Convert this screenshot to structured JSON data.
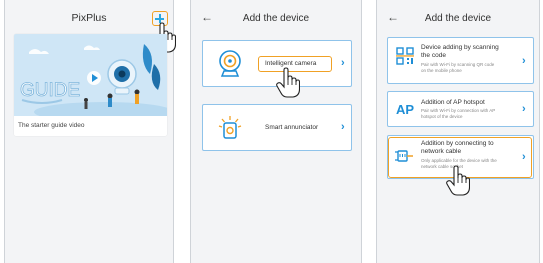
{
  "screen1": {
    "title": "PixPlus",
    "guide_caption": "The starter guide video",
    "guide_art_text": "GUIDE"
  },
  "screen2": {
    "title": "Add the device",
    "items": [
      {
        "label": "Intelligent camera",
        "icon": "camera-icon"
      },
      {
        "label": "Smart annunciator",
        "icon": "annunciator-icon"
      }
    ]
  },
  "screen3": {
    "title": "Add the device",
    "options": [
      {
        "title_line1": "Device adding by scanning",
        "title_line2": "the code",
        "sub_line1": "Pair with Wi-Fi by scanning QR code",
        "sub_line2": "on the mobile phone",
        "icon": "qr-code-icon"
      },
      {
        "title_line1": "Addition of AP hotspot",
        "sub_line1": "Pair with Wi-Fi by connection with AP",
        "sub_line2": "hotspot of the device",
        "icon_text": "AP"
      },
      {
        "title_line1": "Addition by connecting to",
        "title_line2": "network cable",
        "sub_line1": "Only applicable for the device with the",
        "sub_line2": "network cable socket",
        "icon": "network-cable-icon"
      }
    ]
  },
  "colors": {
    "accent_blue": "#1e8ed6",
    "highlight_orange": "#f0a125",
    "card_border": "#8fc3ea",
    "background": "#f3f4f6"
  }
}
